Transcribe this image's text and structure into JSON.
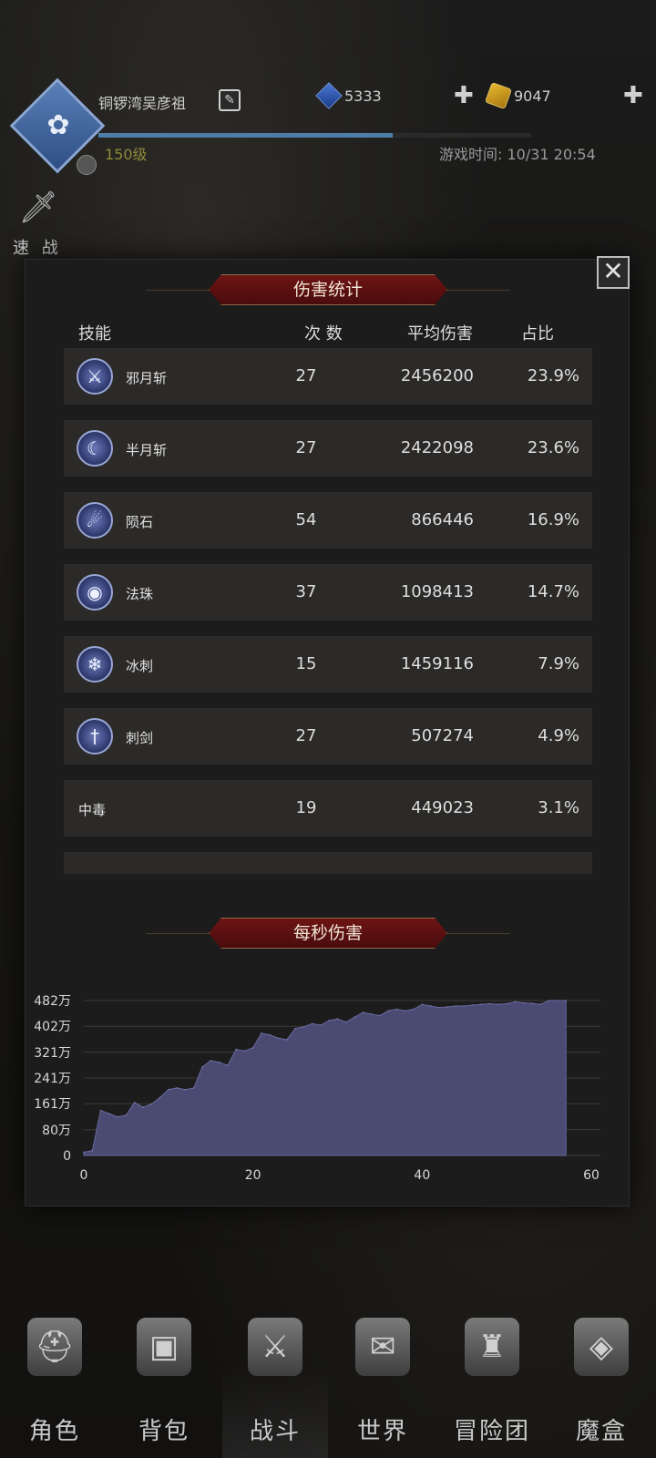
{
  "header": {
    "player_name": "铜锣湾吴彦祖",
    "level": "150级",
    "exp_fraction": 0.68,
    "currency_blue": "5333",
    "currency_gold": "9047",
    "game_time": "游戏时间: 10/31  20:54",
    "quick_battle": "速 战"
  },
  "modal": {
    "title": "伤害统计",
    "close_symbol": "✕",
    "columns": {
      "skill": "技能",
      "count": "次 数",
      "avg": "平均伤害",
      "share": "占比"
    },
    "rows": [
      {
        "name": "邪月斩",
        "count": "27",
        "avg": "2456200",
        "share": "23.9%",
        "icon": "sword-icon"
      },
      {
        "name": "半月斩",
        "count": "27",
        "avg": "2422098",
        "share": "23.6%",
        "icon": "crescent-icon"
      },
      {
        "name": "陨石",
        "count": "54",
        "avg": "866446",
        "share": "16.9%",
        "icon": "meteor-icon"
      },
      {
        "name": "法珠",
        "count": "37",
        "avg": "1098413",
        "share": "14.7%",
        "icon": "orb-icon"
      },
      {
        "name": "冰刺",
        "count": "15",
        "avg": "1459116",
        "share": "7.9%",
        "icon": "ice-spike-icon"
      },
      {
        "name": "刺剑",
        "count": "27",
        "avg": "507274",
        "share": "4.9%",
        "icon": "rapier-icon"
      },
      {
        "name": "中毒",
        "count": "19",
        "avg": "449023",
        "share": "3.1%",
        "icon": ""
      }
    ],
    "dps_title": "每秒伤害"
  },
  "chart_data": {
    "type": "area",
    "title": "每秒伤害",
    "xlabel": "",
    "ylabel": "",
    "xlim": [
      0,
      60
    ],
    "ylim": [
      0,
      482
    ],
    "x_ticks": [
      "0",
      "20",
      "40",
      "60"
    ],
    "y_ticks": [
      "0",
      "80万",
      "161万",
      "241万",
      "321万",
      "402万",
      "482万"
    ],
    "y_tick_values": [
      0,
      80,
      161,
      241,
      321,
      402,
      482
    ],
    "color": "#4a4a72",
    "series": [
      {
        "x": [
          0,
          1,
          2,
          3,
          4,
          5,
          6,
          7,
          8,
          9,
          10,
          11,
          12,
          13,
          14,
          15,
          16,
          17,
          18,
          19,
          20,
          21,
          22,
          23,
          24,
          25,
          26,
          27,
          28,
          29,
          30,
          31,
          32,
          33,
          34,
          35,
          36,
          37,
          38,
          39,
          40,
          41,
          42,
          43,
          44,
          45,
          46,
          47,
          48,
          49,
          50,
          51,
          52,
          53,
          54,
          55,
          56,
          57
        ],
        "values": [
          10,
          15,
          140,
          130,
          120,
          125,
          165,
          150,
          160,
          180,
          205,
          210,
          205,
          210,
          275,
          295,
          290,
          280,
          330,
          325,
          335,
          380,
          375,
          365,
          360,
          395,
          400,
          410,
          405,
          420,
          425,
          415,
          430,
          445,
          440,
          435,
          450,
          455,
          450,
          455,
          470,
          465,
          460,
          462,
          465,
          465,
          468,
          470,
          472,
          470,
          472,
          478,
          475,
          473,
          470,
          482,
          482,
          482
        ]
      }
    ]
  },
  "bottom_nav": [
    {
      "label": "角色",
      "icon": "helmet-icon"
    },
    {
      "label": "背包",
      "icon": "backpack-icon"
    },
    {
      "label": "战斗",
      "icon": "shield-sword-icon"
    },
    {
      "label": "世界",
      "icon": "map-scroll-icon"
    },
    {
      "label": "冒险团",
      "icon": "castle-icon"
    },
    {
      "label": "魔盒",
      "icon": "magic-box-icon"
    }
  ]
}
